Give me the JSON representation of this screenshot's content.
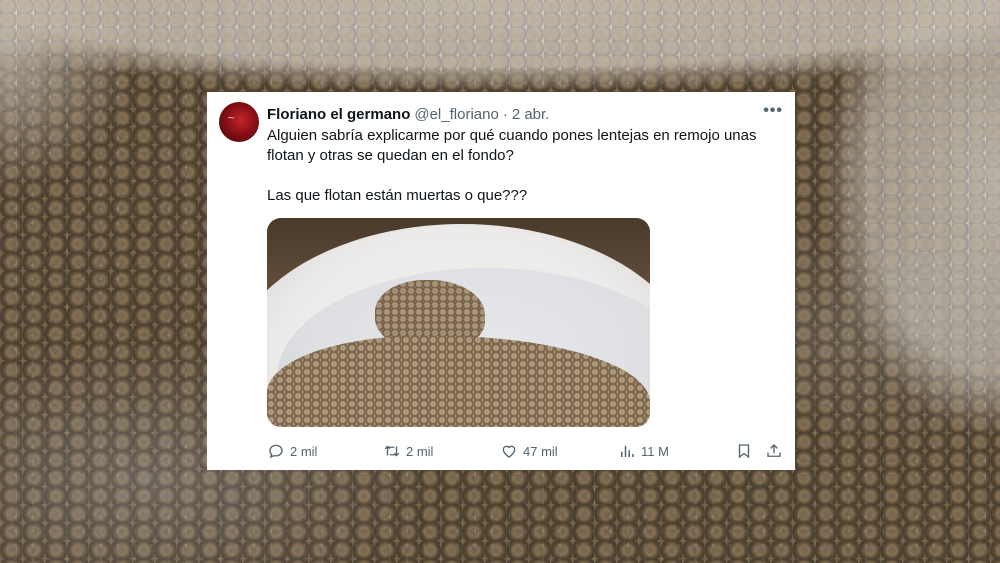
{
  "tweet": {
    "display_name": "Floriano el germano",
    "handle": "@el_floriano",
    "separator": "·",
    "date": "2 abr.",
    "more_label": "•••",
    "text_line1": "Alguien sabría explicarme por qué cuando pones lentejas en remojo unas flotan y otras se quedan en el fondo?",
    "text_line2": "Las que flotan están muertas o que???",
    "replies": "2 mil",
    "retweets": "2 mil",
    "likes": "47 mil",
    "views": "11 M"
  },
  "icons": {
    "reply": "reply-icon",
    "retweet": "retweet-icon",
    "like": "heart-icon",
    "views": "views-icon",
    "bookmark": "bookmark-icon",
    "share": "share-icon",
    "more": "more-icon"
  },
  "colors": {
    "text_primary": "#0f1419",
    "text_secondary": "#536471",
    "card_background": "#ffffff"
  }
}
